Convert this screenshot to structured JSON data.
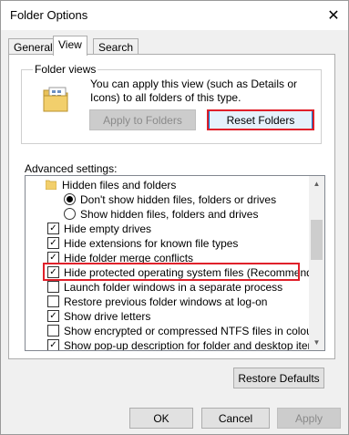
{
  "window": {
    "title": "Folder Options"
  },
  "tabs": [
    {
      "label": "General"
    },
    {
      "label": "View"
    },
    {
      "label": "Search"
    }
  ],
  "folder_views": {
    "legend": "Folder views",
    "description": "You can apply this view (such as Details or Icons) to all folders of this type.",
    "apply_button": "Apply to Folders",
    "reset_button": "Reset Folders"
  },
  "advanced": {
    "label": "Advanced settings:",
    "items": [
      {
        "kind": "folder",
        "label": "Hidden files and folders"
      },
      {
        "kind": "radio",
        "checked": true,
        "label": "Don't show hidden files, folders or drives"
      },
      {
        "kind": "radio",
        "checked": false,
        "label": "Show hidden files, folders and drives"
      },
      {
        "kind": "checkbox",
        "checked": true,
        "label": "Hide empty drives"
      },
      {
        "kind": "checkbox",
        "checked": true,
        "label": "Hide extensions for known file types"
      },
      {
        "kind": "checkbox",
        "checked": true,
        "label": "Hide folder merge conflicts"
      },
      {
        "kind": "checkbox",
        "checked": true,
        "label": "Hide protected operating system files (Recommended)"
      },
      {
        "kind": "checkbox",
        "checked": false,
        "label": "Launch folder windows in a separate process"
      },
      {
        "kind": "checkbox",
        "checked": false,
        "label": "Restore previous folder windows at log-on"
      },
      {
        "kind": "checkbox",
        "checked": true,
        "label": "Show drive letters"
      },
      {
        "kind": "checkbox",
        "checked": false,
        "label": "Show encrypted or compressed NTFS files in colour"
      },
      {
        "kind": "checkbox",
        "checked": true,
        "label": "Show pop-up description for folder and desktop items"
      }
    ]
  },
  "buttons": {
    "restore_defaults": "Restore Defaults",
    "ok": "OK",
    "cancel": "Cancel",
    "apply": "Apply"
  },
  "colors": {
    "highlight_border": "#e0202a",
    "accent": "#0078d7"
  }
}
